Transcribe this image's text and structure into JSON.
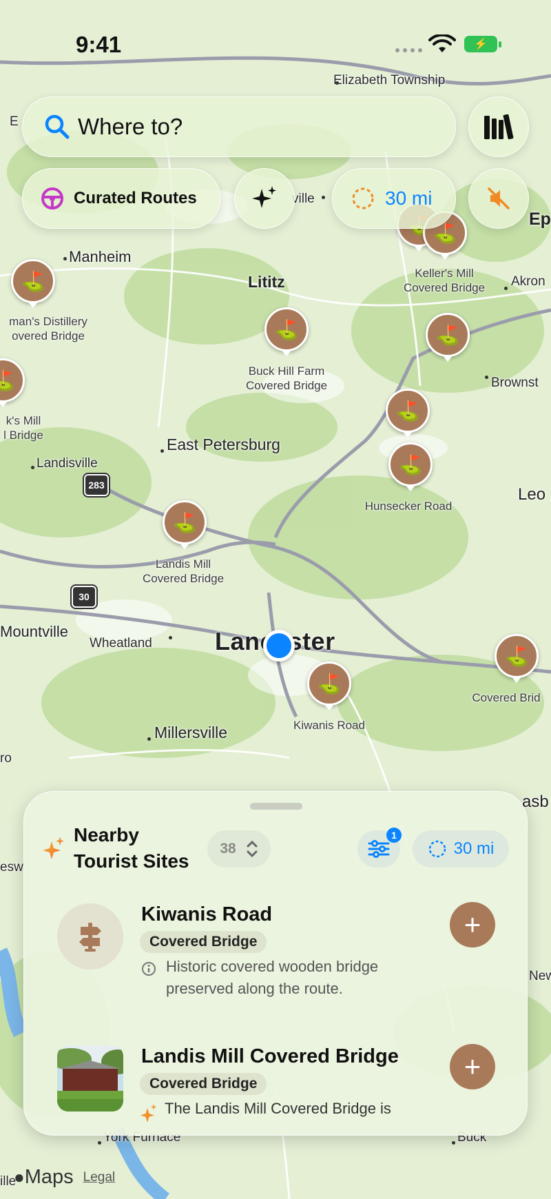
{
  "status_bar": {
    "time": "9:41"
  },
  "search": {
    "placeholder": "Where to?"
  },
  "toolbar": {
    "curated_routes_label": "Curated Routes",
    "radius_label": "30 mi",
    "icons": {
      "search": "magnifying-glass-icon",
      "library": "books-icon",
      "steering": "steering-wheel-icon",
      "sparkle": "sparkles-icon",
      "radius": "dashed-circle-icon",
      "mute": "speaker-slash-icon"
    }
  },
  "map": {
    "towns": {
      "elizabeth": "Elizabeth Township",
      "manheim": "Manheim",
      "lititz": "Lititz",
      "east_petersburg": "East Petersburg",
      "landisville": "Landisville",
      "mountville": "Mountville",
      "wheatland": "Wheatland",
      "lancaster": "Lancaster",
      "millersville": "Millersville",
      "akron": "Akron",
      "brownstown": "Brownst",
      "leola": "Leo",
      "ep": "Ep",
      "new": "New",
      "york_furnace": "York Furnace",
      "buck": "Buck",
      "ville": "ville",
      "ro": "ro",
      "asb": "asb",
      "esw": "esw",
      "ille": "ille",
      "e_frag": "E"
    },
    "highway_shields": {
      "us283": "283",
      "us30": "30"
    },
    "poi_labels": {
      "kellers_mill": [
        "Keller's Mill",
        "Covered Bridge"
      ],
      "distillery": [
        "man's Distillery",
        "overed Bridge"
      ],
      "buck_hill": [
        "Buck Hill Farm",
        "Covered Bridge"
      ],
      "ks_mill": [
        "k's Mill",
        "l Bridge"
      ],
      "hunsecker": [
        "Hunsecker Road"
      ],
      "landis_mill": [
        "Landis Mill",
        "Covered Bridge"
      ],
      "covered_brid": [
        "Covered Brid"
      ],
      "kiwanis": [
        "Kiwanis Road"
      ]
    },
    "pin_icon": "signpost-icon",
    "location_icon": "current-location-dot"
  },
  "sheet": {
    "title_line1": "Nearby",
    "title_line2": "Tourist Sites",
    "count": "38",
    "filter_badge": "1",
    "radius_label": "30 mi",
    "items": [
      {
        "title": "Kiwanis Road",
        "tag": "Covered Bridge",
        "desc_line1": "Historic covered wooden bridge",
        "desc_line2": "preserved along the route.",
        "desc_icon": "info-circle-icon"
      },
      {
        "title": "Landis Mill Covered Bridge",
        "tag": "Covered Bridge",
        "desc_line1": "The Landis Mill Covered Bridge is",
        "desc_icon": "sparkles-icon"
      }
    ]
  },
  "footer": {
    "brand": "Maps",
    "legal": "Legal"
  },
  "colors": {
    "accent": "#0a84ff",
    "pin": "#a97a5a",
    "map_bg": "#dfeccd",
    "park": "#b8d99a"
  }
}
